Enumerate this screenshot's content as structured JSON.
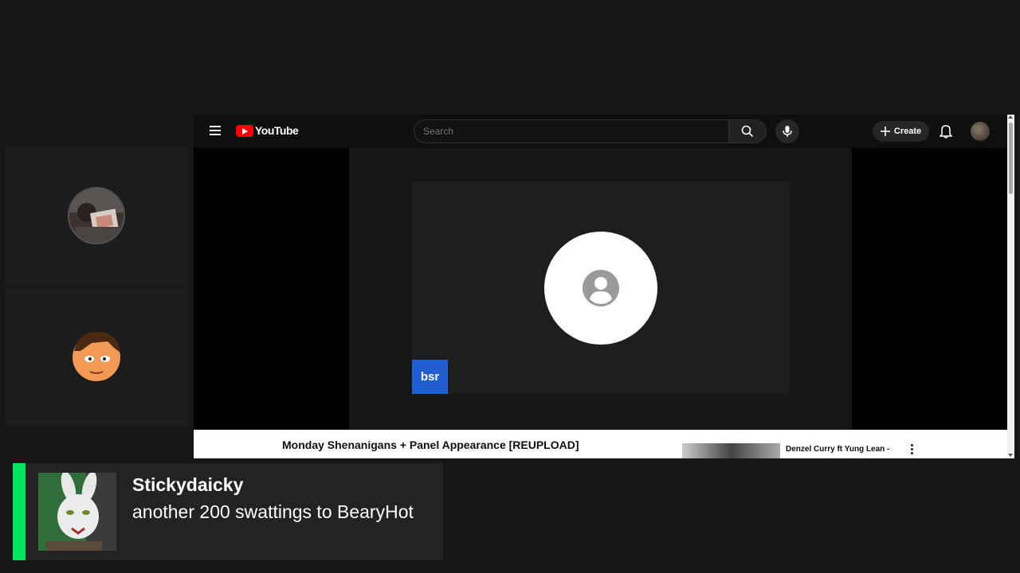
{
  "youtube": {
    "logo_text": "YouTube",
    "search_placeholder": "Search",
    "create_label": "Create",
    "video_title": "Monday Shenanigans + Panel Appearance [REUPLOAD]",
    "recommended": [
      {
        "title": "Denzel Curry ft Yung Lean -"
      }
    ],
    "participant_badge": "bsr"
  },
  "alert": {
    "username": "Stickydaicky",
    "message": "another 200 swattings to BearyHot",
    "accent_color": "#00e65c"
  },
  "colors": {
    "background": "#171717",
    "youtube_red": "#ff0000",
    "badge_blue": "#1f5fd1"
  }
}
